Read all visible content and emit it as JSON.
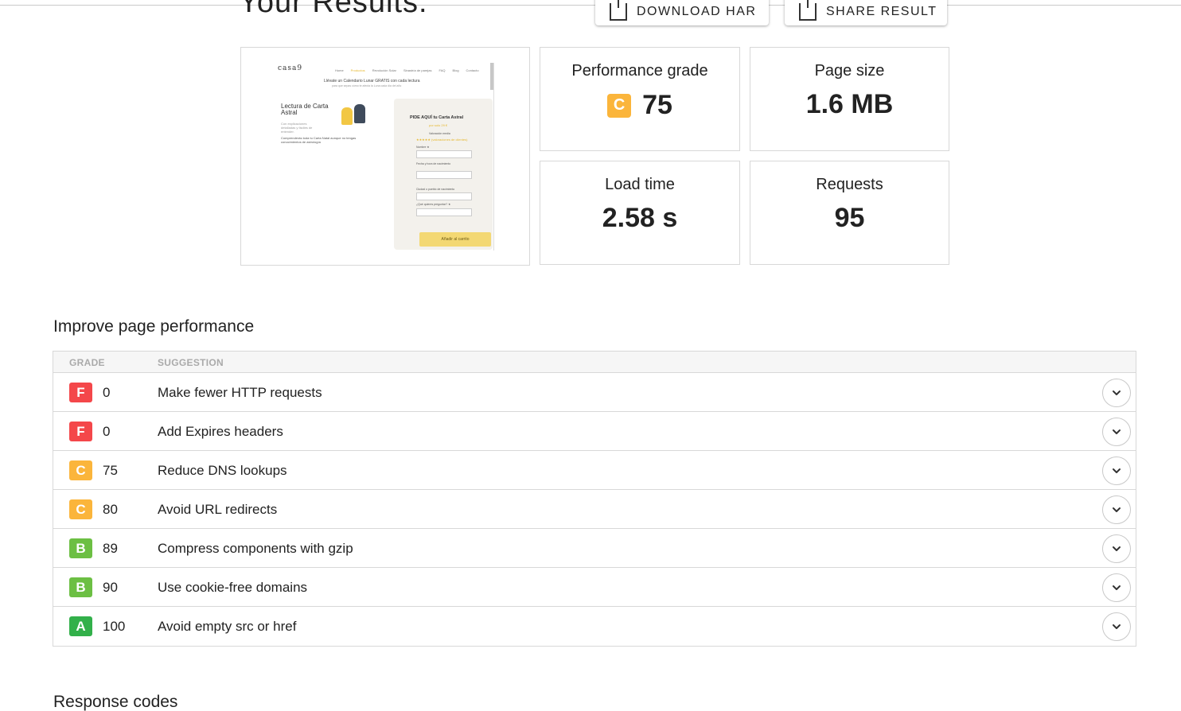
{
  "header": {
    "results_title": "Your Results.",
    "download_har_label": "DOWNLOAD HAR",
    "share_result_label": "SHARE RESULT"
  },
  "screenshot_preview": {
    "logo": "casa9",
    "menu": [
      "Home",
      "Productos",
      "Revolución Solar",
      "Sinastría de parejas",
      "FAQ",
      "Blog",
      "Contacto"
    ],
    "promo": "Llévate un Calendario Lunar GRATIS con cada lectura",
    "promo_sub": "para que sepas cómo te afecta la Luna cada día del año",
    "heading": "Lectura de Carta Astral",
    "subheading": "Con explicaciones detalladas y fáciles de entender.",
    "description": "Comprenderás toda tu Carta Natal aunque no tengas conocimientos de astrología",
    "form_title": "PIDE AQUÍ tu Carta Astral",
    "form_price": "por solo 29 €",
    "form_rating_label": "Valoración media",
    "form_stars": "★★★★★ (valoraciones de clientes)",
    "form_fields": [
      "Nombre ★",
      "Fecha y hora de nacimiento",
      "Ciudad o pueblo de nacimiento",
      "¿Qué quieres preguntar? ★"
    ],
    "form_button": "Añadir al carrito"
  },
  "stats": {
    "performance_grade_label": "Performance grade",
    "performance_grade_letter": "C",
    "performance_grade_value": "75",
    "page_size_label": "Page size",
    "page_size_value": "1.6 MB",
    "load_time_label": "Load time",
    "load_time_value": "2.58 s",
    "requests_label": "Requests",
    "requests_value": "95"
  },
  "improve": {
    "title": "Improve page performance",
    "col_grade": "GRADE",
    "col_suggestion": "SUGGESTION",
    "rows": [
      {
        "grade": "F",
        "score": "0",
        "suggestion": "Make fewer HTTP requests",
        "color": "#f4474a"
      },
      {
        "grade": "F",
        "score": "0",
        "suggestion": "Add Expires headers",
        "color": "#f4474a"
      },
      {
        "grade": "C",
        "score": "75",
        "suggestion": "Reduce DNS lookups",
        "color": "#fbb53b"
      },
      {
        "grade": "C",
        "score": "80",
        "suggestion": "Avoid URL redirects",
        "color": "#fbb53b"
      },
      {
        "grade": "B",
        "score": "89",
        "suggestion": "Compress components with gzip",
        "color": "#6cbf43"
      },
      {
        "grade": "B",
        "score": "90",
        "suggestion": "Use cookie-free domains",
        "color": "#6cbf43"
      },
      {
        "grade": "A",
        "score": "100",
        "suggestion": "Avoid empty src or href",
        "color": "#32b04a"
      }
    ]
  },
  "response_codes": {
    "title": "Response codes"
  },
  "colors": {
    "grade_c": "#fbb53b",
    "border": "#d8d8d8"
  },
  "icons": {
    "download": "download-icon",
    "share": "share-icon",
    "expand": "chevron-down-icon"
  }
}
